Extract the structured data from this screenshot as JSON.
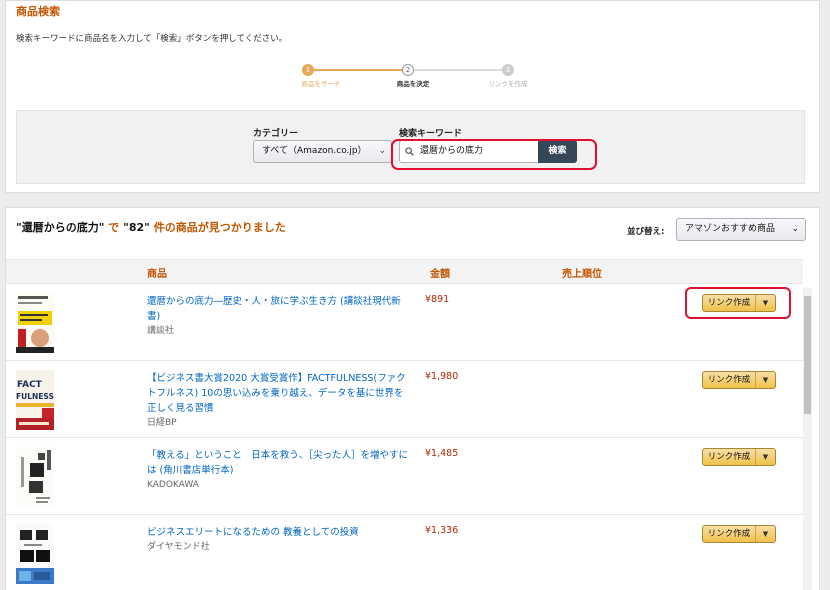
{
  "search_panel": {
    "title": "商品検索",
    "description": "検索キーワードに商品名を入力して「検索」ボタンを押してください。",
    "steps": [
      {
        "num": "1",
        "label": "商品をサーチ"
      },
      {
        "num": "2",
        "label": "商品を決定"
      },
      {
        "num": "3",
        "label": "リンクを作成"
      }
    ],
    "category_label": "カテゴリー",
    "category_value": "すべて（Amazon.co.jp）",
    "keyword_label": "検索キーワード",
    "keyword_value": "還暦からの底力",
    "search_button": "検索"
  },
  "results": {
    "summary_query": "\"還暦からの底力\"",
    "summary_de": " で ",
    "summary_count": "\"82\"",
    "summary_tail": " 件の商品が見つかりました",
    "sort_label": "並び替え:",
    "sort_value": "アマゾンおすすめ商品",
    "columns": {
      "product": "商品",
      "price": "金額",
      "rank": "売上順位"
    },
    "link_button_label": "リンク作成",
    "items": [
      {
        "title": "還暦からの底力―歴史・人・旅に学ぶ生き方 (講談社現代新書)",
        "publisher": "講談社",
        "price": "¥891"
      },
      {
        "title": "【ビジネス書大賞2020 大賞受賞作】FACTFULNESS(ファクトフルネス) 10の思い込みを乗り越え、データを基に世界を正しく見る習慣",
        "publisher": "日経BP",
        "price": "¥1,980"
      },
      {
        "title": "「教える」ということ　日本を救う、［尖った人］を増やすには (角川書店単行本)",
        "publisher": "KADOKAWA",
        "price": "¥1,485"
      },
      {
        "title": "ビジネスエリートになるための 教養としての投資",
        "publisher": "ダイヤモンド社",
        "price": "¥1,336"
      }
    ]
  },
  "colors": {
    "accent": "#c45500",
    "link": "#0066c0",
    "price": "#b12704",
    "highlight": "#e0102e",
    "button": "#f0c14b"
  }
}
